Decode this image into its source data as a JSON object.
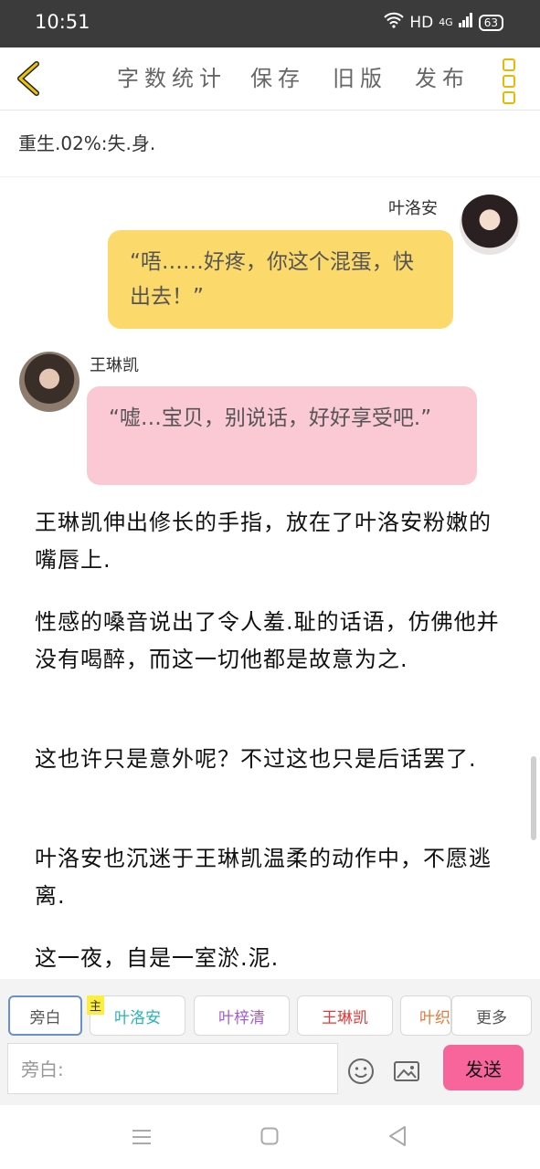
{
  "status": {
    "time": "10:51",
    "network": "HD",
    "signal": "4G",
    "battery": "63"
  },
  "toolbar": {
    "word_count": "字数统计",
    "save": "保存",
    "old_version": "旧版",
    "publish": "发布"
  },
  "title": "重生.02%:失.身.",
  "chat": [
    {
      "speaker": "叶洛安",
      "text": "“唔……好疼，你这个混蛋，快出去！”"
    },
    {
      "speaker": "王琳凯",
      "text": "“嘘…宝贝，别说话，好好享受吧.”"
    }
  ],
  "paragraphs": [
    "王琳凯伸出修长的手指，放在了叶洛安粉嫩的嘴唇上.",
    "性感的嗓音说出了令人羞.耻的话语，仿佛他并没有喝醉，而这一切他都是故意为之.",
    "这也许只是意外呢？不过这也只是后话罢了.",
    "叶洛安也沉迷于王琳凯温柔的动作中，不愿逃离.",
    "这一夜，自是一室淤.泥."
  ],
  "roles": {
    "narration": "旁白",
    "main_tag": "主",
    "r1": "叶洛安",
    "r2": "叶梓清",
    "r3": "王琳凯",
    "r4": "叶织",
    "more": "更多"
  },
  "input": {
    "placeholder": "旁白:"
  },
  "send": "发送",
  "colors": {
    "yellow_bubble": "#fcd96b",
    "pink_bubble": "#fbc9d4",
    "send": "#f8659a",
    "r1": "#28b4b4",
    "r2": "#a35bd6",
    "r3": "#e03a3a",
    "r4": "#e07a3a"
  }
}
